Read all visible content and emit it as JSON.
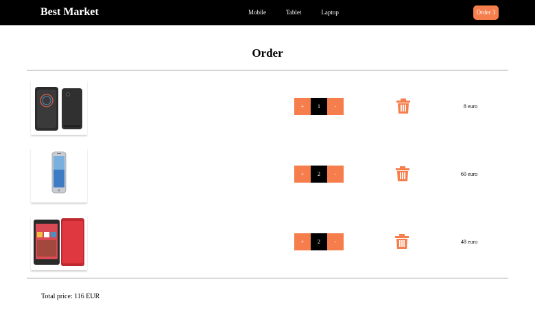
{
  "header": {
    "brand": "Best Market",
    "nav": [
      "Mobile",
      "Tablet",
      "Laptop"
    ],
    "order_button": "Order 3"
  },
  "page_title": "Order",
  "items": [
    {
      "product": "htc-phone-flip-case",
      "minus": "+",
      "quantity": "1",
      "plus": "-",
      "price": "8 euro"
    },
    {
      "product": "iphone",
      "minus": "+",
      "quantity": "2",
      "plus": "-",
      "price": "60 euro"
    },
    {
      "product": "htc-desire-red",
      "minus": "+",
      "quantity": "2",
      "plus": "-",
      "price": "48 euro"
    }
  ],
  "total": "Total price: 116 EUR",
  "colors": {
    "accent": "#f67e4c",
    "navbar": "#000000"
  }
}
